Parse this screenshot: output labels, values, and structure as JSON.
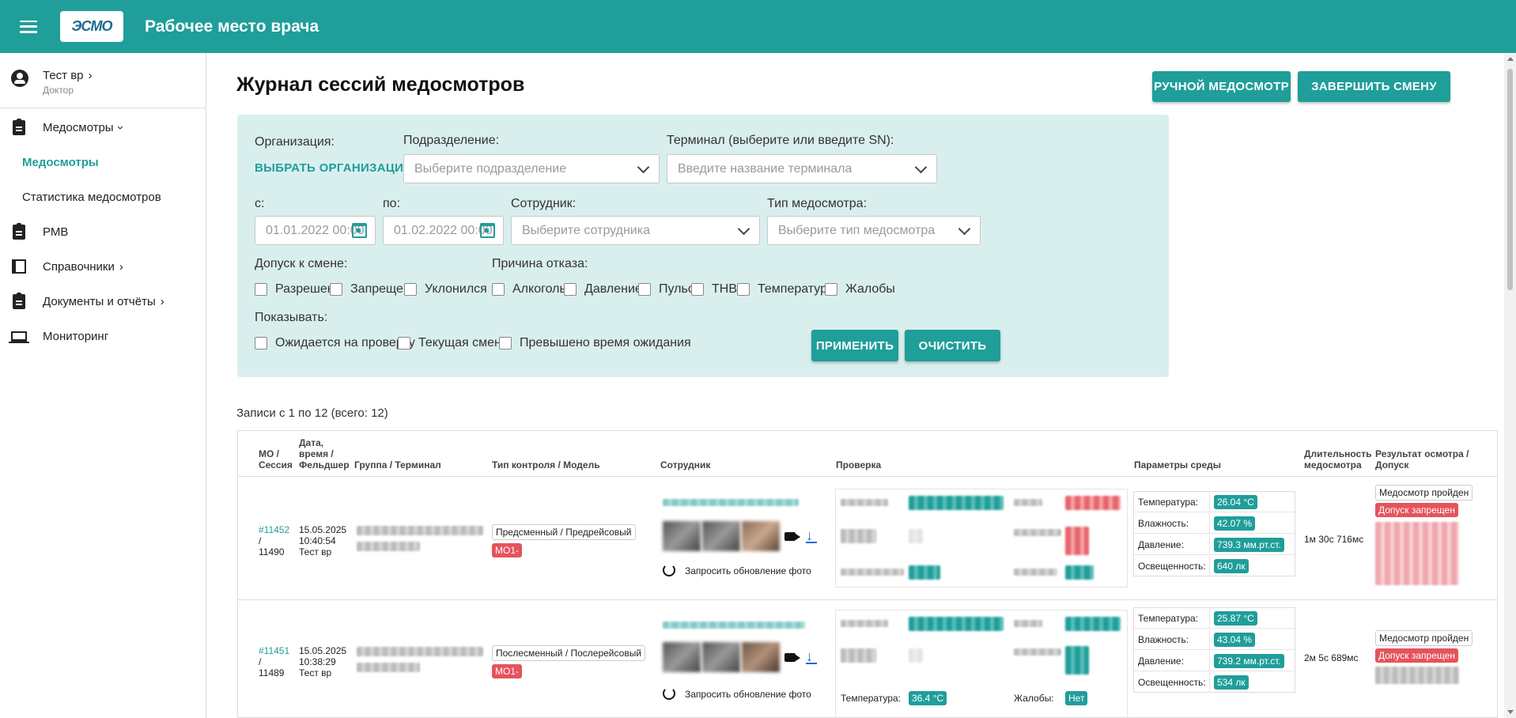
{
  "header": {
    "title": "Рабочее место врача",
    "logo_text": "ЭСМО"
  },
  "sidebar": {
    "user": {
      "name": "Тест вр",
      "role": "Доктор"
    },
    "items": [
      {
        "label": "Медосмотры",
        "icon": "clipboard-icon"
      },
      {
        "label": "Медосмотры"
      },
      {
        "label": "Статистика медосмотров"
      },
      {
        "label": "РМВ",
        "icon": "clipboard-icon"
      },
      {
        "label": "Справочники",
        "icon": "books-icon"
      },
      {
        "label": "Документы и отчёты",
        "icon": "clipboard-icon"
      },
      {
        "label": "Мониторинг",
        "icon": "laptop-icon"
      }
    ]
  },
  "page": {
    "title": "Журнал сессий медосмотров",
    "btn_manual": "РУЧНОЙ МЕДОСМОТР",
    "btn_end": "ЗАВЕРШИТЬ СМЕНУ"
  },
  "filters": {
    "org_label": "Организация:",
    "org_link": "ВЫБРАТЬ ОРГАНИЗАЦИЮ",
    "dept_label": "Подразделение:",
    "dept_placeholder": "Выберите подразделение",
    "term_label": "Терминал (выберите или введите SN):",
    "term_placeholder": "Введите название терминала",
    "from_label": "с:",
    "from_value": "01.01.2022 00:00",
    "to_label": "по:",
    "to_value": "01.02.2022 00:00",
    "emp_label": "Сотрудник:",
    "emp_placeholder": "Выберите сотрудника",
    "type_label": "Тип медосмотра:",
    "type_placeholder": "Выберите тип медосмотра",
    "admit_label": "Допуск к смене:",
    "admit_options": [
      "Разрешен",
      "Запрещен",
      "Уклонился"
    ],
    "reason_label": "Причина отказа:",
    "reason_options": [
      "Алкоголь",
      "Давление",
      "Пульс",
      "ТНВ",
      "Температура",
      "Жалобы"
    ],
    "show_label": "Показывать:",
    "show_options": [
      "Ожидается на проверку",
      "Текущая смена",
      "Превышено время ожидания"
    ],
    "apply": "ПРИМЕНИТЬ",
    "clear": "ОЧИСТИТЬ"
  },
  "records_text": "Записи с 1 по 12 (всего: 12)",
  "table": {
    "headers": {
      "mo": "МО / Сессия",
      "date": "Дата, время / Фельдшер",
      "group": "Группа / Терминал",
      "type": "Тип контроля / Модель",
      "employee": "Сотрудник",
      "check": "Проверка",
      "env": "Параметры среды",
      "duration": "Длительность медосмотра",
      "result": "Результат осмотра / Допуск"
    },
    "photo_refresh": "Запросить обновление фото",
    "env_labels": [
      "Температура:",
      "Влажность:",
      "Давление:",
      "Освещенность:"
    ],
    "rows": [
      {
        "mo": "#11452",
        "session": "11490",
        "date": "15.05.2025",
        "time": "10:40:54",
        "medic": "Тест вр",
        "type": "Предсменный / Предрейсовый",
        "model": "МО1-",
        "env": [
          "26.04 °C",
          "42.07 %",
          "739.3 мм.рт.ст.",
          "640 лк"
        ],
        "duration": "1м 30с 716мс",
        "result": "Медосмотр пройден",
        "admit": "Допуск запрещен"
      },
      {
        "mo": "#11451",
        "session": "11489",
        "date": "15.05.2025",
        "time": "10:38:29",
        "medic": "Тест вр",
        "type": "Послесменный / Послерейсовый",
        "model": "МО1-",
        "check_temp_label": "Температура:",
        "check_temp": "36.4 °C",
        "check_complaints_label": "Жалобы:",
        "check_complaints": "Нет",
        "env": [
          "25.87 °C",
          "43.04 %",
          "739.2 мм.рт.ст.",
          "534 лк"
        ],
        "duration": "2м 5с 689мс",
        "result": "Медосмотр пройден",
        "admit": "Допуск запрещен"
      }
    ]
  },
  "colors": {
    "accent": "#1f9e9a",
    "danger": "#e5535b",
    "filter_bg": "#d9efee"
  }
}
